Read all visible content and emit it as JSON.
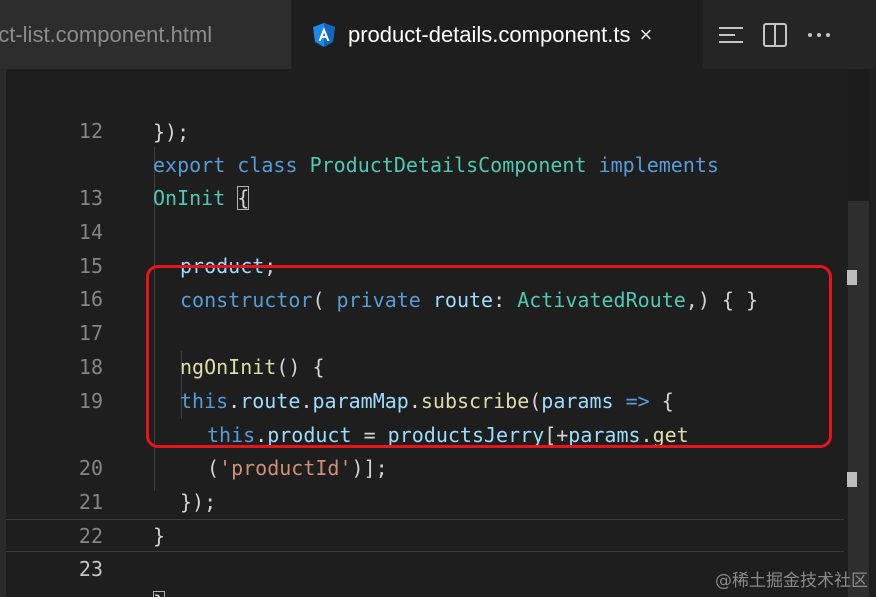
{
  "tabs": [
    {
      "label": "uct-list.component.html",
      "active": false
    },
    {
      "label": "product-details.component.ts",
      "active": true,
      "close": "×",
      "icon": "angular-icon"
    }
  ],
  "actions": [
    "split-horizontal-icon",
    "split-editor-icon",
    "more-icon"
  ],
  "lines": [
    {
      "no": "",
      "text": "});"
    },
    {
      "no": "12",
      "text": "export class ProductDetailsComponent implements"
    },
    {
      "no": "",
      "text": "OnInit {"
    },
    {
      "no": "13",
      "text": ""
    },
    {
      "no": "14",
      "text": "product;"
    },
    {
      "no": "15",
      "text": "constructor( private route: ActivatedRoute,) { }"
    },
    {
      "no": "16",
      "text": ""
    },
    {
      "no": "17",
      "text": "ngOnInit() {"
    },
    {
      "no": "18",
      "text": "this.route.paramMap.subscribe(params => {"
    },
    {
      "no": "19",
      "text": "this.product = productsJerry[+params.get"
    },
    {
      "no": "",
      "text": "('productId')];"
    },
    {
      "no": "20",
      "text": "});"
    },
    {
      "no": "21",
      "text": "}"
    },
    {
      "no": "22",
      "text": ""
    },
    {
      "no": "23",
      "text": "}"
    }
  ],
  "active_line": "23",
  "colors": {
    "highlight": "#e8141c",
    "keyword": "#569cd6",
    "class": "#4ec9b0",
    "variable": "#9cdcfe",
    "function": "#dcdcaa",
    "string": "#ce9178"
  },
  "watermark": "@稀土掘金技术社区"
}
